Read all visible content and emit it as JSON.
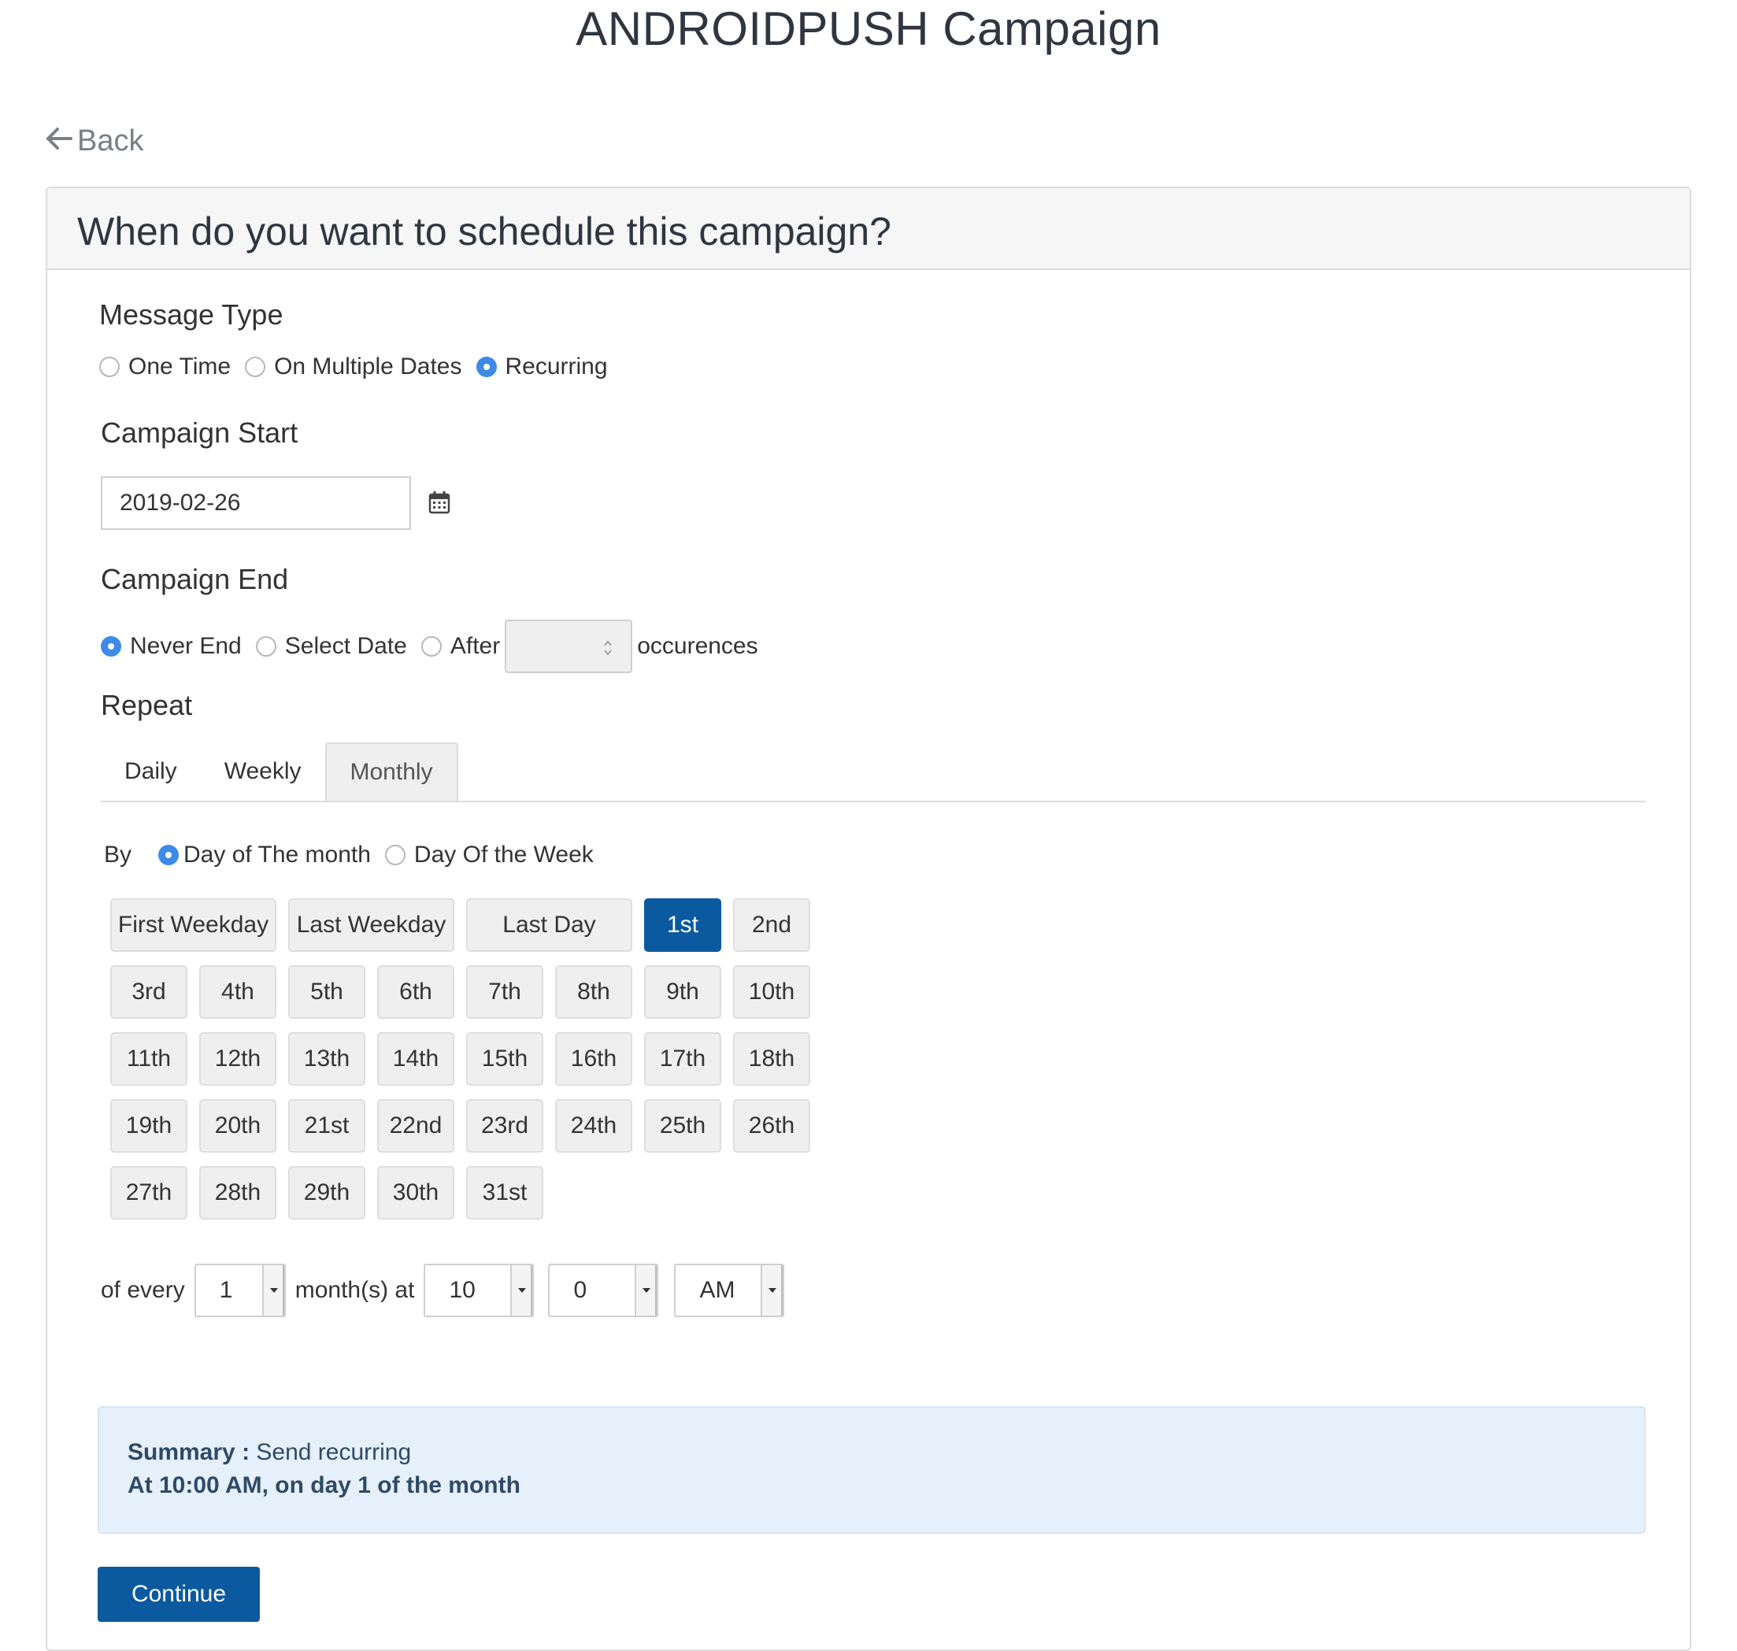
{
  "page": {
    "title": "ANDROIDPUSH Campaign"
  },
  "nav": {
    "back_label": "Back"
  },
  "card": {
    "title": "When do you want to schedule this campaign?"
  },
  "message_type": {
    "label": "Message Type",
    "options": [
      {
        "label": "One Time",
        "checked": false
      },
      {
        "label": "On Multiple Dates",
        "checked": false
      },
      {
        "label": "Recurring",
        "checked": true
      }
    ]
  },
  "campaign_start": {
    "label": "Campaign Start",
    "value": "2019-02-26"
  },
  "campaign_end": {
    "label": "Campaign End",
    "options": [
      {
        "label": "Never End",
        "checked": true
      },
      {
        "label": "Select Date",
        "checked": false
      },
      {
        "label": "After",
        "checked": false
      }
    ],
    "occurrences_value": "",
    "occurrences_suffix": "occurences"
  },
  "repeat": {
    "label": "Repeat",
    "tabs": [
      {
        "label": "Daily",
        "active": false
      },
      {
        "label": "Weekly",
        "active": false
      },
      {
        "label": "Monthly",
        "active": true
      }
    ]
  },
  "by": {
    "label": "By",
    "options": [
      {
        "label": "Day of The month",
        "checked": true
      },
      {
        "label": "Day Of the Week",
        "checked": false
      }
    ]
  },
  "days": {
    "special": [
      "First Weekday",
      "Last Weekday",
      "Last Day"
    ],
    "numbered": [
      "1st",
      "2nd",
      "3rd",
      "4th",
      "5th",
      "6th",
      "7th",
      "8th",
      "9th",
      "10th",
      "11th",
      "12th",
      "13th",
      "14th",
      "15th",
      "16th",
      "17th",
      "18th",
      "19th",
      "20th",
      "21st",
      "22nd",
      "23rd",
      "24th",
      "25th",
      "26th",
      "27th",
      "28th",
      "29th",
      "30th",
      "31st"
    ],
    "selected": "1st"
  },
  "schedule": {
    "of_every_label": "of every",
    "months_value": "1",
    "months_at_label": "month(s) at",
    "hour_value": "10",
    "minute_value": "0",
    "ampm_value": "AM"
  },
  "summary": {
    "label": "Summary :",
    "text": "Send recurring",
    "detail": "At 10:00 AM, on day 1 of the month"
  },
  "actions": {
    "continue_label": "Continue"
  },
  "colors": {
    "primary": "#0b5aa0",
    "radio_active": "#3d8ae8",
    "summary_bg": "#e5f0fb"
  }
}
